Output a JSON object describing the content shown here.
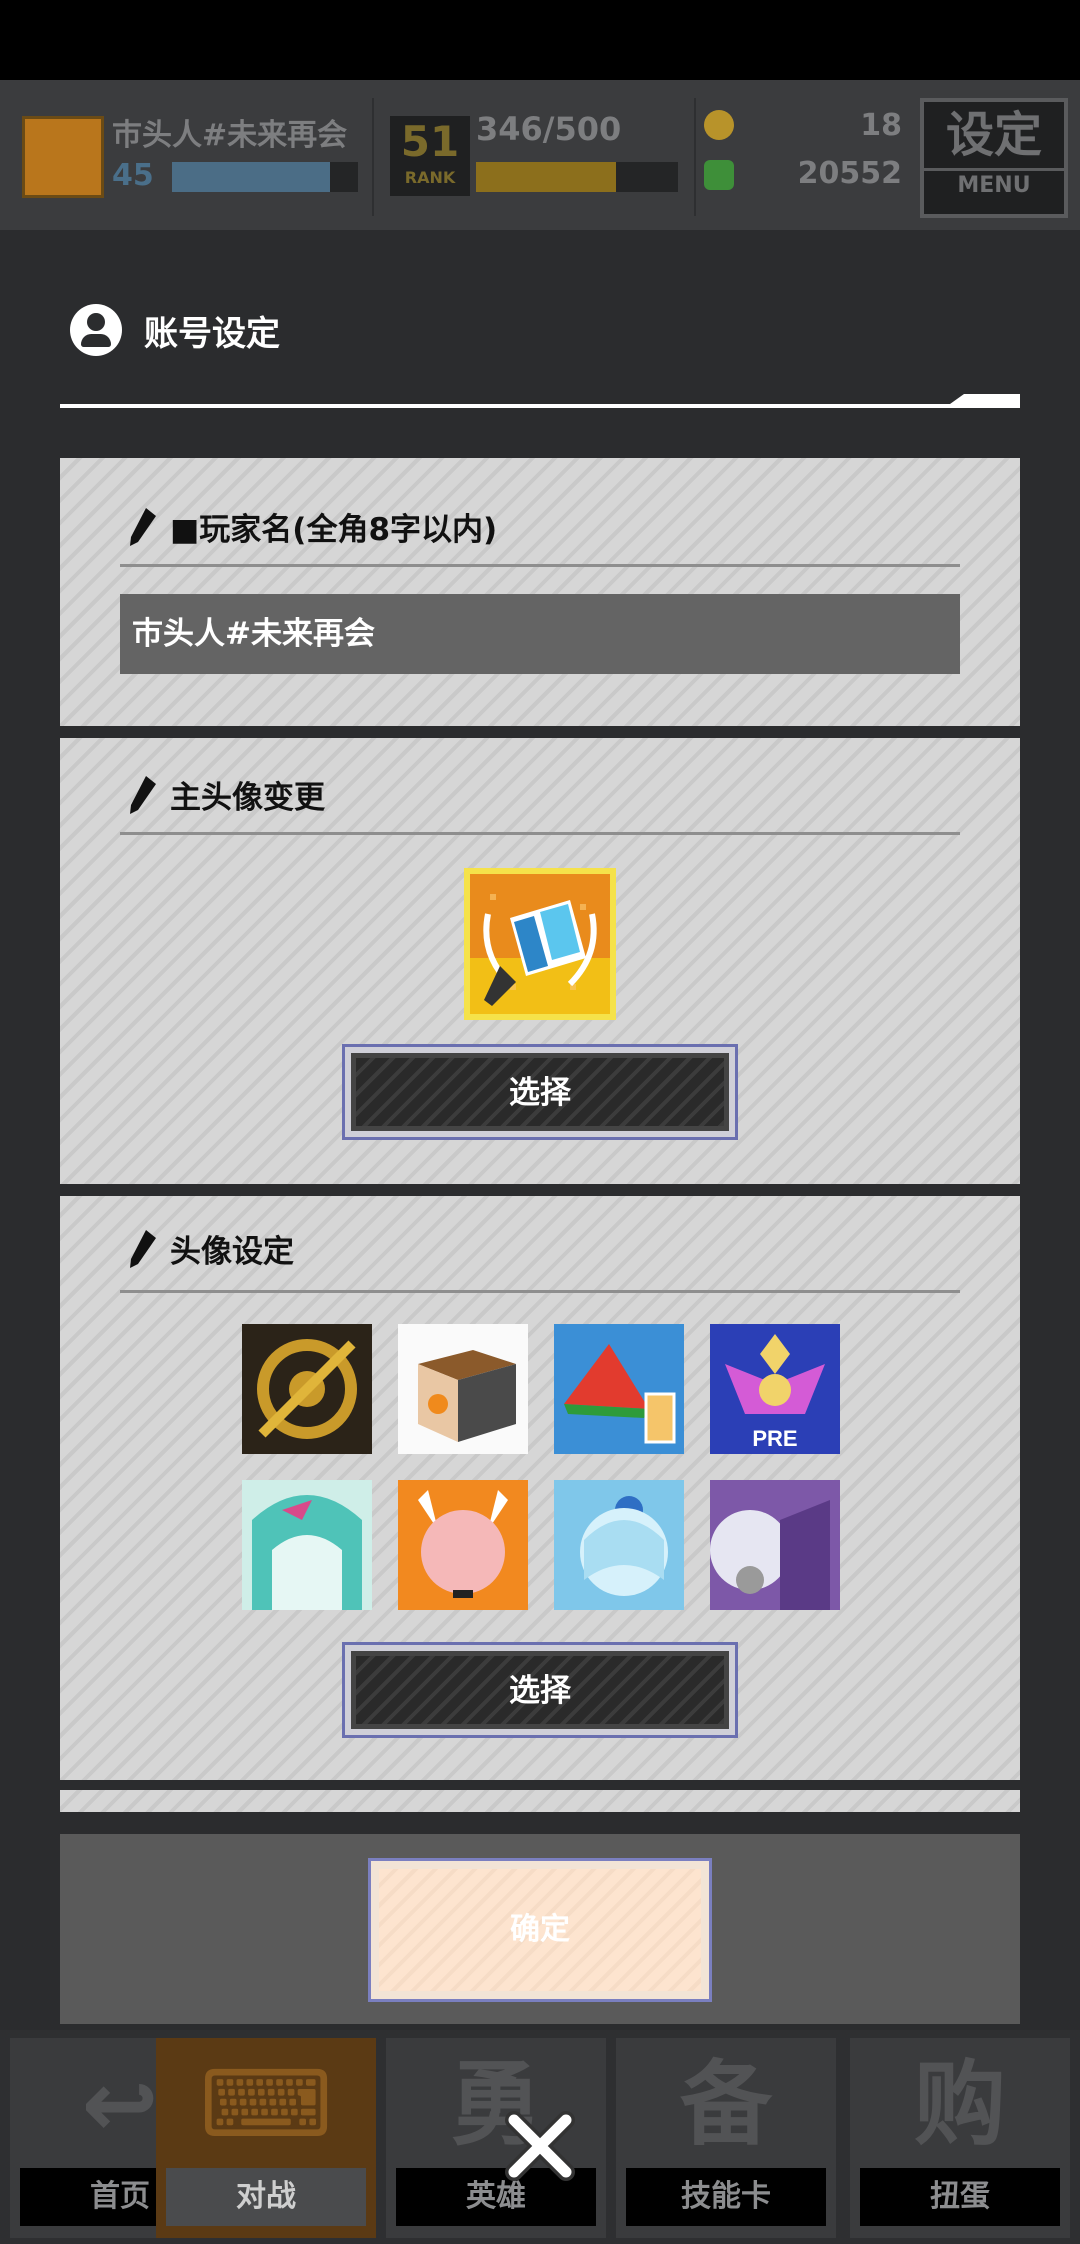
{
  "hud": {
    "player_name": "巿头人#未来再会",
    "level": "45",
    "level_progress": 0.85,
    "rank_number": "51",
    "rank_label": "RANK",
    "exp_text": "346/500",
    "exp_progress": 0.692,
    "currency1": "18",
    "currency2": "20552",
    "settings_label": "设定",
    "settings_sub": "MENU",
    "colors": {
      "currency1": "#b8932a",
      "currency2": "#3e8f39"
    }
  },
  "modal": {
    "title": "账号设定",
    "player_name_section": {
      "title": "■玩家名(全角8字以内)",
      "value": "巿头人#未来再会"
    },
    "main_avatar_section": {
      "title": "主头像变更",
      "select_label": "选择"
    },
    "avatar_set_section": {
      "title": "头像设定",
      "select_label": "选择",
      "icons": [
        {
          "name": "gear-emblem-icon"
        },
        {
          "name": "orange-box-icon"
        },
        {
          "name": "watermelon-drink-icon"
        },
        {
          "name": "pre-crest-icon",
          "text": "PRE"
        },
        {
          "name": "miku-icon"
        },
        {
          "name": "fox-girl-icon"
        },
        {
          "name": "blue-hair-girl-icon"
        },
        {
          "name": "purple-hair-girl-icon"
        }
      ]
    },
    "confirm_label": "确定"
  },
  "bottom_nav": {
    "items": [
      {
        "label": "首页",
        "glyph": "↩"
      },
      {
        "label": "对战",
        "glyph": "⌨"
      },
      {
        "label": "英雄",
        "glyph": "勇"
      },
      {
        "label": "技能卡",
        "glyph": "备"
      },
      {
        "label": "扭蛋",
        "glyph": "购"
      }
    ]
  },
  "close_icon": "close-icon"
}
